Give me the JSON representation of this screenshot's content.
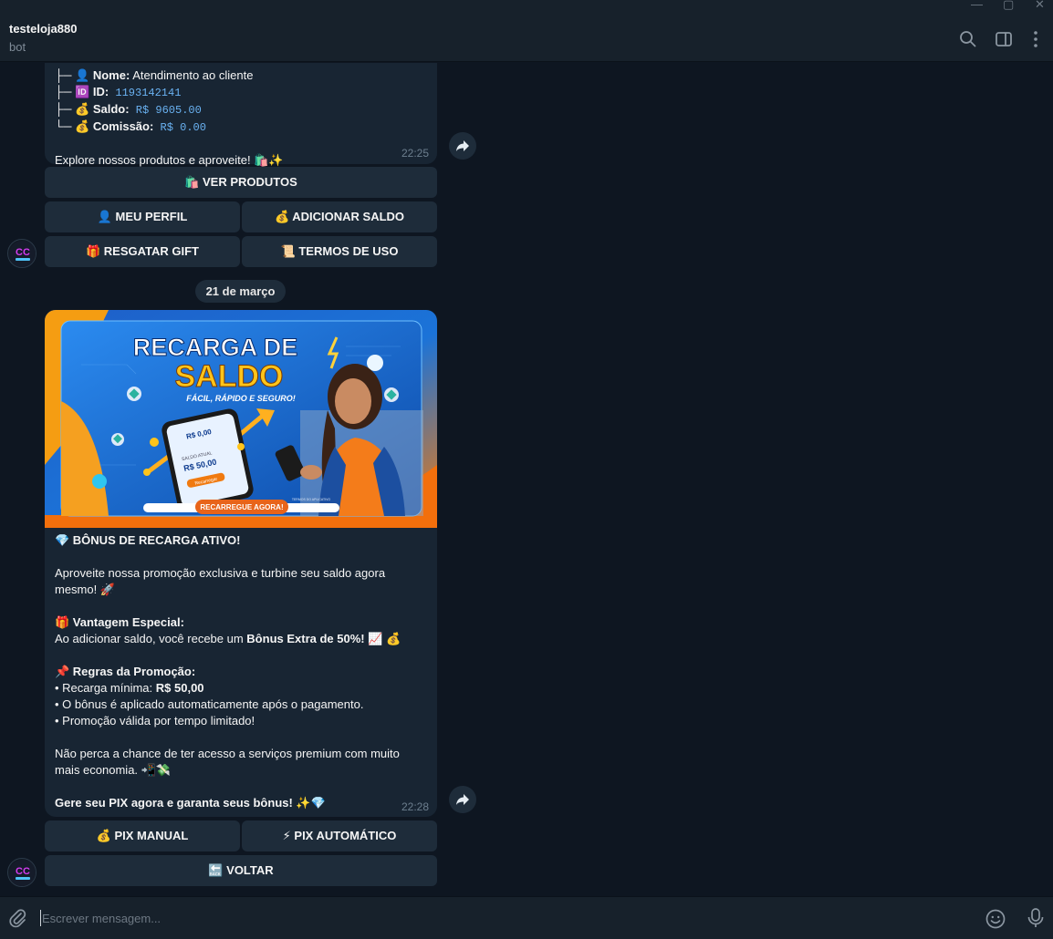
{
  "window": {
    "minimize": "—",
    "maximize": "▢",
    "close": "✕"
  },
  "header": {
    "chat_name": "testeloja880",
    "status": "bot"
  },
  "message1": {
    "lines": [
      {
        "prefix": "├─ 👤 ",
        "label": "Nome:",
        "value": " Atendimento ao cliente",
        "mono": false
      },
      {
        "prefix": "├─ 🆔 ",
        "label": "ID:",
        "value": " 1193142141",
        "mono": true
      },
      {
        "prefix": "├─ 💰 ",
        "label": "Saldo:",
        "value": " R$ 9605.00",
        "mono": true
      },
      {
        "prefix": "└─ 💰 ",
        "label": "Comissão:",
        "value": " R$ 0.00",
        "mono": true
      }
    ],
    "footer": "Explore nossos produtos e aproveite! 🛍️✨",
    "time": "22:25"
  },
  "keyboard1": {
    "ver_produtos": "🛍️ VER PRODUTOS",
    "meu_perfil": "👤 MEU PERFIL",
    "adicionar_saldo": "💰 ADICIONAR SALDO",
    "resgatar_gift": "🎁 RESGATAR GIFT",
    "termos_de_uso": "📜 TERMOS DE USO"
  },
  "date_separator": "21 de março",
  "banner": {
    "headline_1": "RECARGA DE",
    "headline_2": "SALDO",
    "tagline": "FÁCIL, RÁPIDO E SEGURO!",
    "phone_balance_1": "R$ 0,00",
    "phone_balance_label": "SALDO ATUAL",
    "phone_balance_2": "R$ 50,00",
    "phone_button": "Recarregar",
    "cta": "RECARREGUE AGORA!",
    "fine_print": "TERMOS DO APLICATIVO"
  },
  "message2": {
    "title": "💎 BÔNUS DE RECARGA ATIVO!",
    "intro_1": "Aproveite nossa promoção exclusiva e turbine seu saldo agora",
    "intro_2": "mesmo! 🚀",
    "vantagem_title": "🎁 Vantagem Especial:",
    "vantagem_text": "Ao adicionar saldo, você recebe um ",
    "vantagem_bold": "Bônus Extra de 50%!",
    "vantagem_emoji": " 📈 💰",
    "regras_title": "📌 Regras da Promoção:",
    "regra_1_text": "• Recarga mínima: ",
    "regra_1_bold": "R$ 50,00",
    "regra_2": "• O bônus é aplicado automaticamente após o pagamento.",
    "regra_3": "• Promoção válida por tempo limitado!",
    "outro_1": "Não perca a chance de ter acesso a serviços premium com muito",
    "outro_2": "mais economia. 📲💸",
    "closing": "Gere seu PIX agora e garanta seus bônus! ✨💎",
    "time": "22:28"
  },
  "keyboard2": {
    "pix_manual": "💰 PIX MANUAL",
    "pix_automatico": "⚡ PIX AUTOMÁTICO",
    "voltar": "🔙 VOLTAR"
  },
  "composer": {
    "placeholder": "Escrever mensagem..."
  },
  "colors": {
    "bg": "#0e1621",
    "header": "#17212b",
    "bubble": "#182533",
    "button": "#1e2c3a",
    "link": "#6ab2f2"
  }
}
